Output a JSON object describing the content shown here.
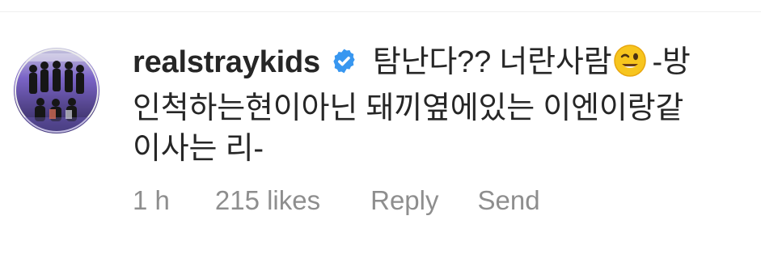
{
  "comment": {
    "username": "realstraykids",
    "verified": true,
    "text": {
      "line1": "탐난다?? 너란사람",
      "emoji": "winking-face",
      "line1_tail": "-방",
      "line2": "인척하는현이아닌 돼끼옆에있는 이엔이랑같",
      "line3": "이사는 리-"
    },
    "meta": {
      "time": "1 h",
      "likes": "215 likes",
      "reply_label": "Reply",
      "send_label": "Send"
    }
  },
  "colors": {
    "text": "#262626",
    "muted": "#8e8e8e",
    "verified_badge": "#3897f0",
    "divider": "#efefef",
    "emoji": "#f7c51e"
  },
  "icons": {
    "avatar": "group-photo-avatar",
    "verified": "verified-badge-icon",
    "emoji": "winking-face-emoji"
  }
}
